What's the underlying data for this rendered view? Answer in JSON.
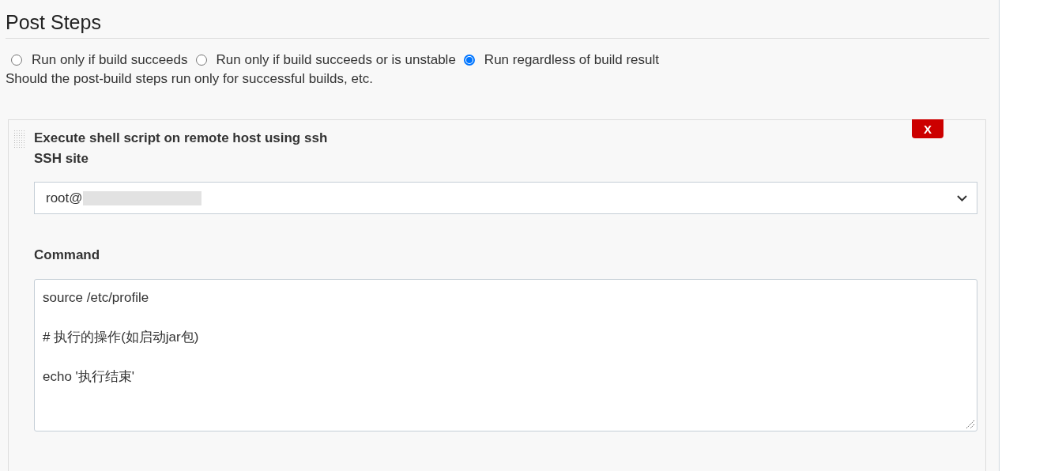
{
  "section": {
    "title": "Post Steps"
  },
  "run_condition": {
    "options": [
      {
        "label": "Run only if build succeeds",
        "selected": false
      },
      {
        "label": "Run only if build succeeds or is unstable",
        "selected": false
      },
      {
        "label": "Run regardless of build result",
        "selected": true
      }
    ],
    "description": "Should the post-build steps run only for successful builds, etc."
  },
  "build_step": {
    "title": "Execute shell script on remote host using ssh",
    "delete_button": "X",
    "ssh_site": {
      "label": "SSH site",
      "value": "root@"
    },
    "command": {
      "label": "Command",
      "value": "source /etc/profile\n\n# 执行的操作(如启动jar包)\n\necho '执行结束'"
    }
  }
}
